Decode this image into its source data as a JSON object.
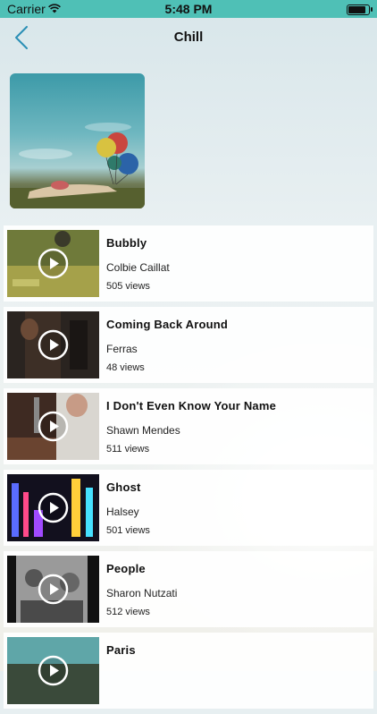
{
  "status": {
    "carrier": "Carrier",
    "time": "5:48 PM",
    "battery_level": 0.95
  },
  "nav": {
    "title": "Chill"
  },
  "songs": [
    {
      "title": "Bubbly",
      "artist": "Colbie Caillat",
      "views": "505 views"
    },
    {
      "title": "Coming Back Around",
      "artist": "Ferras",
      "views": "48 views"
    },
    {
      "title": "I Don't Even Know Your Name",
      "artist": "Shawn Mendes",
      "views": "511 views"
    },
    {
      "title": "Ghost",
      "artist": "Halsey",
      "views": "501 views"
    },
    {
      "title": "People",
      "artist": "Sharon Nutzati",
      "views": "512 views"
    },
    {
      "title": "Paris",
      "artist": "",
      "views": ""
    }
  ],
  "colors": {
    "status_bar": "#4fc0b6",
    "accent": "#2a8fb5"
  }
}
